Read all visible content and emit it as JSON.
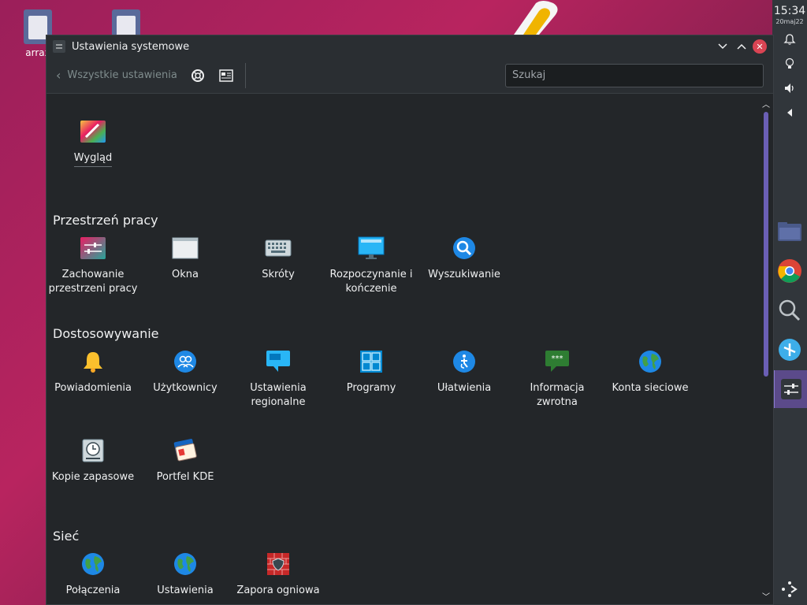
{
  "desktop": {
    "icons": [
      {
        "label": "arrax"
      }
    ]
  },
  "panel": {
    "time": "15:34",
    "date": "20maj22"
  },
  "window": {
    "title": "Ustawienia systemowe",
    "back_label": "Wszystkie ustawienia",
    "search_placeholder": "Szukaj"
  },
  "sections": {
    "top": {
      "items": [
        {
          "label": "Wygląd"
        }
      ]
    },
    "workspace": {
      "title": "Przestrzeń pracy",
      "items": [
        {
          "label": "Zachowanie przestrzeni pracy"
        },
        {
          "label": "Okna"
        },
        {
          "label": "Skróty"
        },
        {
          "label": "Rozpoczynanie i kończenie"
        },
        {
          "label": "Wyszukiwanie"
        }
      ]
    },
    "personalization": {
      "title": "Dostosowywanie",
      "items": [
        {
          "label": "Powiadomienia"
        },
        {
          "label": "Użytkownicy"
        },
        {
          "label": "Ustawienia regionalne"
        },
        {
          "label": "Programy"
        },
        {
          "label": "Ułatwienia"
        },
        {
          "label": "Informacja zwrotna"
        },
        {
          "label": "Konta sieciowe"
        },
        {
          "label": "Kopie zapasowe"
        },
        {
          "label": "Portfel KDE"
        }
      ]
    },
    "network": {
      "title": "Sieć",
      "items": [
        {
          "label": "Połączenia"
        },
        {
          "label": "Ustawienia"
        },
        {
          "label": "Zapora ogniowa"
        }
      ]
    }
  },
  "colors": {
    "accent": "#6b5fb5",
    "window_bg": "#232629",
    "close": "#da4453"
  }
}
